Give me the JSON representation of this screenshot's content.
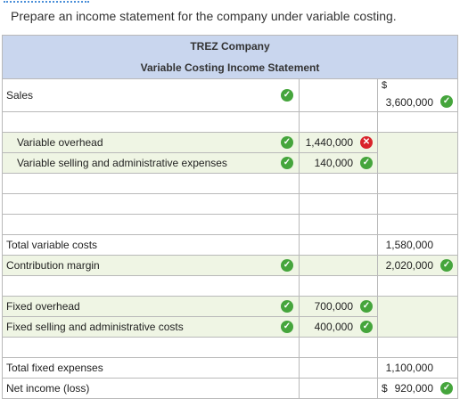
{
  "prompt": "Prepare an income statement for the company under variable costing.",
  "statement": {
    "company": "TREZ Company",
    "title": "Variable Costing Income Statement"
  },
  "rows": {
    "sales": {
      "label": "Sales",
      "dollar": "$",
      "value": "3,600,000"
    },
    "var_overhead": {
      "label": "Variable overhead",
      "value": "1,440,000"
    },
    "var_selling": {
      "label": "Variable selling and administrative expenses",
      "value": "140,000"
    },
    "total_var": {
      "label": "Total variable costs",
      "value": "1,580,000"
    },
    "contribution": {
      "label": "Contribution margin",
      "value": "2,020,000"
    },
    "fixed_overhead": {
      "label": "Fixed overhead",
      "value": "700,000"
    },
    "fixed_selling": {
      "label": "Fixed selling and administrative costs",
      "value": "400,000"
    },
    "total_fixed": {
      "label": "Total fixed expenses",
      "value": "1,100,000"
    },
    "net_income": {
      "label": "Net income (loss)",
      "dollar": "$",
      "value": "920,000"
    }
  },
  "icons": {
    "correct": "check-icon",
    "incorrect": "x-icon"
  },
  "colors": {
    "header_bg": "#c9d6ee",
    "shaded_row": "#eff5e4",
    "correct": "#45a53c",
    "incorrect": "#d9232b"
  }
}
